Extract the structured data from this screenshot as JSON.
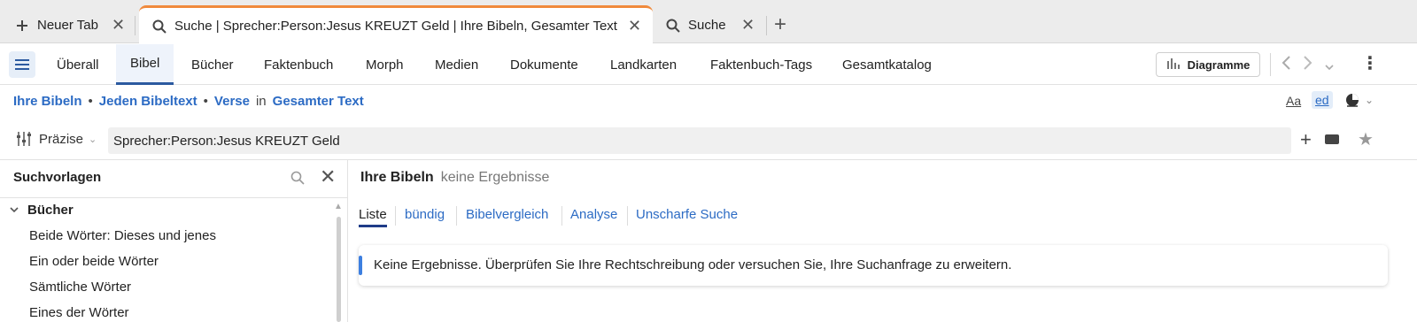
{
  "tabs": [
    {
      "label": "Neuer Tab",
      "icon": "plus-icon"
    },
    {
      "label": "Suche | Sprecher:Person:Jesus KREUZT Geld | Ihre Bibeln, Gesamter Text",
      "icon": "search-icon",
      "active": true
    },
    {
      "label": "Suche",
      "icon": "search-icon"
    }
  ],
  "nav": {
    "items": [
      "Überall",
      "Bibel",
      "Bücher",
      "Faktenbuch",
      "Morph",
      "Medien",
      "Dokumente",
      "Landkarten",
      "Faktenbuch-Tags",
      "Gesamtkatalog"
    ],
    "active": "Bibel",
    "chart_button": "Diagramme"
  },
  "breadcrumb": {
    "scope": "Ihre Bibeln",
    "text": "Jeden Bibeltext",
    "unit": "Verse",
    "in_label": "in",
    "range": "Gesamter Text"
  },
  "toolbar": {
    "font_label": "Aa",
    "ed_label": "ed"
  },
  "search": {
    "precision_label": "Präzise",
    "query": "Sprecher:Person:Jesus KREUZT Geld"
  },
  "sidebar": {
    "title": "Suchvorlagen",
    "group": "Bücher",
    "items": [
      "Beide Wörter: Dieses und jenes",
      "Ein oder beide Wörter",
      "Sämtliche Wörter",
      "Eines der Wörter"
    ]
  },
  "main": {
    "title": "Ihre Bibeln",
    "subtitle": "keine Ergebnisse",
    "subtabs": [
      "Liste",
      "bündig",
      "Bibelvergleich",
      "Analyse",
      "Unscharfe Suche"
    ],
    "message": "Keine Ergebnisse. Überprüfen Sie Ihre Rechtschreibung oder versuchen Sie, Ihre Suchanfrage zu erweitern."
  },
  "colors": {
    "accent": "#2c6bc4",
    "active_tab_border": "#f08a3c",
    "nav_active": "#2c5aa0"
  }
}
